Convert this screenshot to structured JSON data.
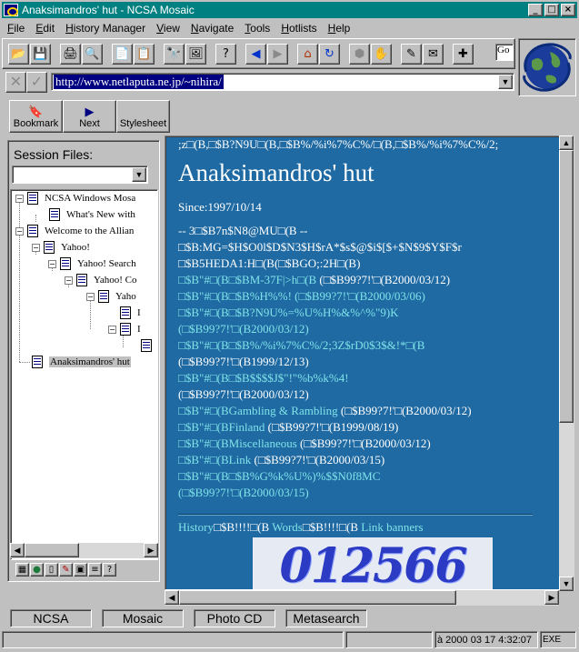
{
  "window": {
    "title": "Anaksimandros' hut - NCSA Mosaic",
    "minimize": "_",
    "maximize": "□",
    "close": "×"
  },
  "menu": [
    "File",
    "Edit",
    "History Manager",
    "View",
    "Navigate",
    "Tools",
    "Hotlists",
    "Help"
  ],
  "address": {
    "url": "http://www.netlaputa.ne.jp/~nihira/",
    "goto_stub": "Go"
  },
  "nav_buttons": {
    "bookmark": "Bookmark",
    "next": "Next",
    "stylesheet": "Stylesheet"
  },
  "session": {
    "label": "Session Files:",
    "tree": [
      {
        "label": "NCSA Windows Mosa"
      },
      {
        "label": "What's New with"
      },
      {
        "label": "Welcome to the Allian"
      },
      {
        "label": "Yahoo!"
      },
      {
        "label": "Yahoo! Search"
      },
      {
        "label": "Yahoo! Co"
      },
      {
        "label": "Yaho"
      },
      {
        "label": "I"
      },
      {
        "label": "I"
      },
      {
        "label": ""
      },
      {
        "label": "Anaksimandros' hut"
      }
    ]
  },
  "content": {
    "top_line": ";z□(B,□$B?N9U□(B,□$B%/%i%7%C%/□(B,□$B%/%i%7%C%/2;",
    "heading": "Anaksimandros' hut",
    "since": "Since:1997/10/14",
    "line1": "-- 3□$B7n$N8@MU□(B --",
    "line2": "□$B:MG=$H$O0l$D$N3$H$rA*$s$@$i$[$+$N$9$Y$F$r",
    "line3": "□$B5HEDA1:H□(B(□$BGO;:2H□(B)",
    "entries": [
      {
        "link": "□$B\"#□(B□$BM-37F|>h□(B",
        "tail": " (□$B99?7!'□(B2000/03/12)"
      },
      {
        "link": "□$B\"#□(B□$B%H%%! (□$B99?7!'□(B2000/03/06)",
        "tail": ""
      },
      {
        "link": "□$B\"#□(B□$B?N9U%=%U%H%&%^%\"9)K",
        "tail": ""
      },
      {
        "link": "",
        "tail": "(□$B99?7!'□(B2000/03/12)"
      },
      {
        "link": "□$B\"#□(B□$B%/%i%7%C%/2;3Z$rD0$3$&!*□(B",
        "tail": ""
      },
      {
        "link": "",
        "tail": "(□$B99?7!'□(B1999/12/13)"
      },
      {
        "link": "□$B\"#□(B□$B$$$$J$\"!\"%b%k%4!",
        "tail": ""
      },
      {
        "link": "",
        "tail": "(□$B99?7!'□(B2000/03/12)"
      },
      {
        "link": "□$B\"#□(BGambling & Rambling",
        "tail": " (□$B99?7!'□(B2000/03/12)"
      },
      {
        "link": "□$B\"#□(BFinland",
        "tail": " (□$B99?7!'□(B1999/08/19)"
      },
      {
        "link": "□$B\"#□(BMiscellaneous",
        "tail": " (□$B99?7!'□(B2000/03/12)"
      },
      {
        "link": "□$B\"#□(BLink",
        "tail": " (□$B99?7!'□(B2000/03/15)"
      },
      {
        "link": "□$B\"#□(B□$B%G%k%U%)%$$N0f8MC",
        "tail": ""
      },
      {
        "link": "",
        "tail": "(□$B99?7!'□(B2000/03/15)"
      }
    ],
    "bottom_links": {
      "history": "History",
      "sep1": "□$B!!!!□(B ",
      "words": "Words",
      "sep2": "□$B!!!!□(B ",
      "banners": "Link banners"
    },
    "counter_digits": "012566"
  },
  "tabs": [
    "NCSA",
    "Mosaic",
    "Photo CD",
    "Metasearch"
  ],
  "status": {
    "datetime": "à 2000 03 17 4:32:07",
    "indicator": "EXE"
  }
}
